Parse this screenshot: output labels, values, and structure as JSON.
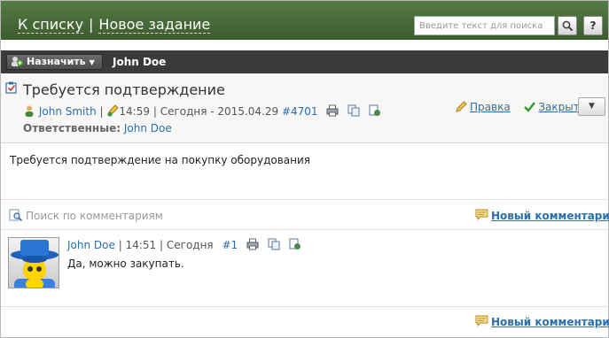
{
  "header": {
    "back_link": "К списку",
    "separator": "|",
    "new_task_link": "Новое задание",
    "search_placeholder": "Введите текст для поиска",
    "help_label": "?"
  },
  "toolbar": {
    "assign_label": "Назначить",
    "assignee_name": "John Doe"
  },
  "task": {
    "title": "Требуется подтверждение",
    "author": "John Smith",
    "sep1": "|",
    "time": "14:59",
    "sep2": "|",
    "date_text": "Сегодня - 2015.04.29",
    "id": "#4701",
    "responsible_label": "Ответственные:",
    "responsible_name": "John Doe",
    "edit_label": "Правка",
    "close_label": "Закрыть",
    "body": "Требуется подтверждение на покупку оборудования"
  },
  "comments": {
    "search_placeholder": "Поиск по комментариям",
    "new_comment_top": "Новый комментарий",
    "new_comment_bottom": "Новый комментарий",
    "items": [
      {
        "author": "John Doe",
        "sep1": "|",
        "time": "14:51",
        "sep2": "|",
        "date_text": "Сегодня",
        "num": "#1",
        "text": "Да, можно закупать."
      }
    ]
  },
  "colors": {
    "header_green": "#3d5c2f",
    "toolbar_dark": "#3a3a3a",
    "link_blue": "#2b6eab",
    "accent_green": "#2e9a2e"
  }
}
